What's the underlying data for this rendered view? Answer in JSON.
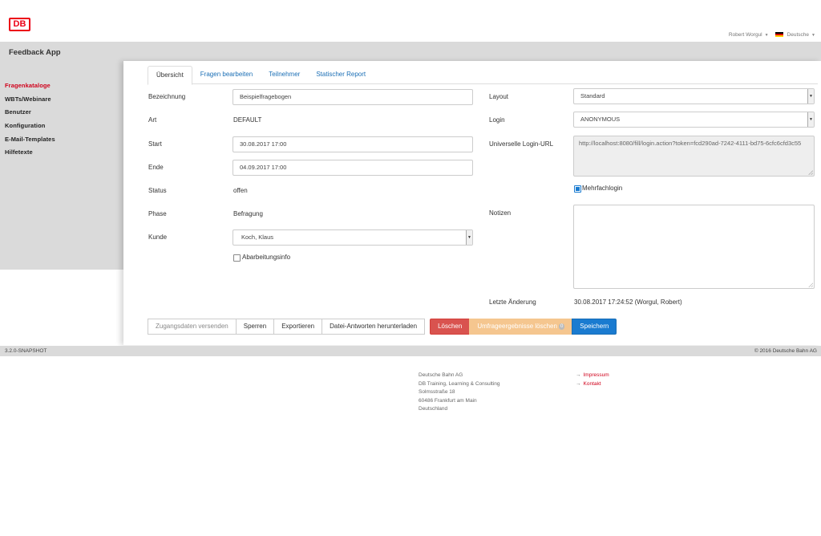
{
  "brand": {
    "logo_text": "DB",
    "color": "#ec0016"
  },
  "user_menu": {
    "user": "Robert Worgul",
    "language": "Deutsche"
  },
  "app": {
    "title": "Feedback App"
  },
  "sidebar": {
    "items": [
      {
        "label": "Fragenkataloge",
        "active": true
      },
      {
        "label": "WBTs/Webinare",
        "active": false
      },
      {
        "label": "Benutzer",
        "active": false
      },
      {
        "label": "Konfiguration",
        "active": false
      },
      {
        "label": "E-Mail-Templates",
        "active": false
      },
      {
        "label": "Hilfetexte",
        "active": false
      }
    ]
  },
  "tabs": [
    {
      "label": "Übersicht",
      "active": true
    },
    {
      "label": "Fragen bearbeiten",
      "active": false
    },
    {
      "label": "Teilnehmer",
      "active": false
    },
    {
      "label": "Statischer Report",
      "active": false
    }
  ],
  "form": {
    "bezeichnung": {
      "label": "Bezeichnung",
      "value": "Beispielfragebogen"
    },
    "art": {
      "label": "Art",
      "value": "DEFAULT"
    },
    "start": {
      "label": "Start",
      "value": "30.08.2017 17:00"
    },
    "ende": {
      "label": "Ende",
      "value": "04.09.2017 17:00"
    },
    "status": {
      "label": "Status",
      "value": "offen"
    },
    "phase": {
      "label": "Phase",
      "value": "Befragung"
    },
    "kunde": {
      "label": "Kunde",
      "value": "Koch, Klaus"
    },
    "abarbeitungsinfo": {
      "label": "Abarbeitungsinfo",
      "checked": false
    },
    "layout": {
      "label": "Layout",
      "value": "Standard"
    },
    "login": {
      "label": "Login",
      "value": "ANONYMOUS"
    },
    "login_url": {
      "label": "Universelle Login-URL",
      "value": "http://localhost:8080/fill/login.action?token=fcd290ad-7242-4111-bd75-6cfc6cfd3c55"
    },
    "mehrfachlogin": {
      "label": "Mehrfachlogin",
      "checked": true
    },
    "notizen": {
      "label": "Notizen",
      "value": ""
    },
    "letzte_aenderung": {
      "label": "Letzte Änderung",
      "value": "30.08.2017 17:24:52 (Worgul, Robert)"
    }
  },
  "actions": {
    "send": "Zugangsdaten versenden",
    "lock": "Sperren",
    "export": "Exportieren",
    "download": "Datei-Antworten herunterladen",
    "delete": "Löschen",
    "delete_results": "Umfrageergebnisse löschen",
    "delete_results_badge": "0",
    "save": "Speichern"
  },
  "footer": {
    "version": "3.2.0-SNAPSHOT",
    "copyright": "© 2016 Deutsche Bahn AG",
    "address": [
      "Deutsche Bahn AG",
      "DB Training, Learning & Consulting",
      "Solmsstraße 18",
      "60486 Frankfurt am Main",
      "Deutschland"
    ],
    "links": [
      "Impressum",
      "Kontakt"
    ]
  },
  "colors": {
    "accent": "#1a7bd0",
    "danger": "#d9534f",
    "warning": "#f5c68f",
    "nav_active": "#d0011b",
    "band": "#dadada"
  }
}
